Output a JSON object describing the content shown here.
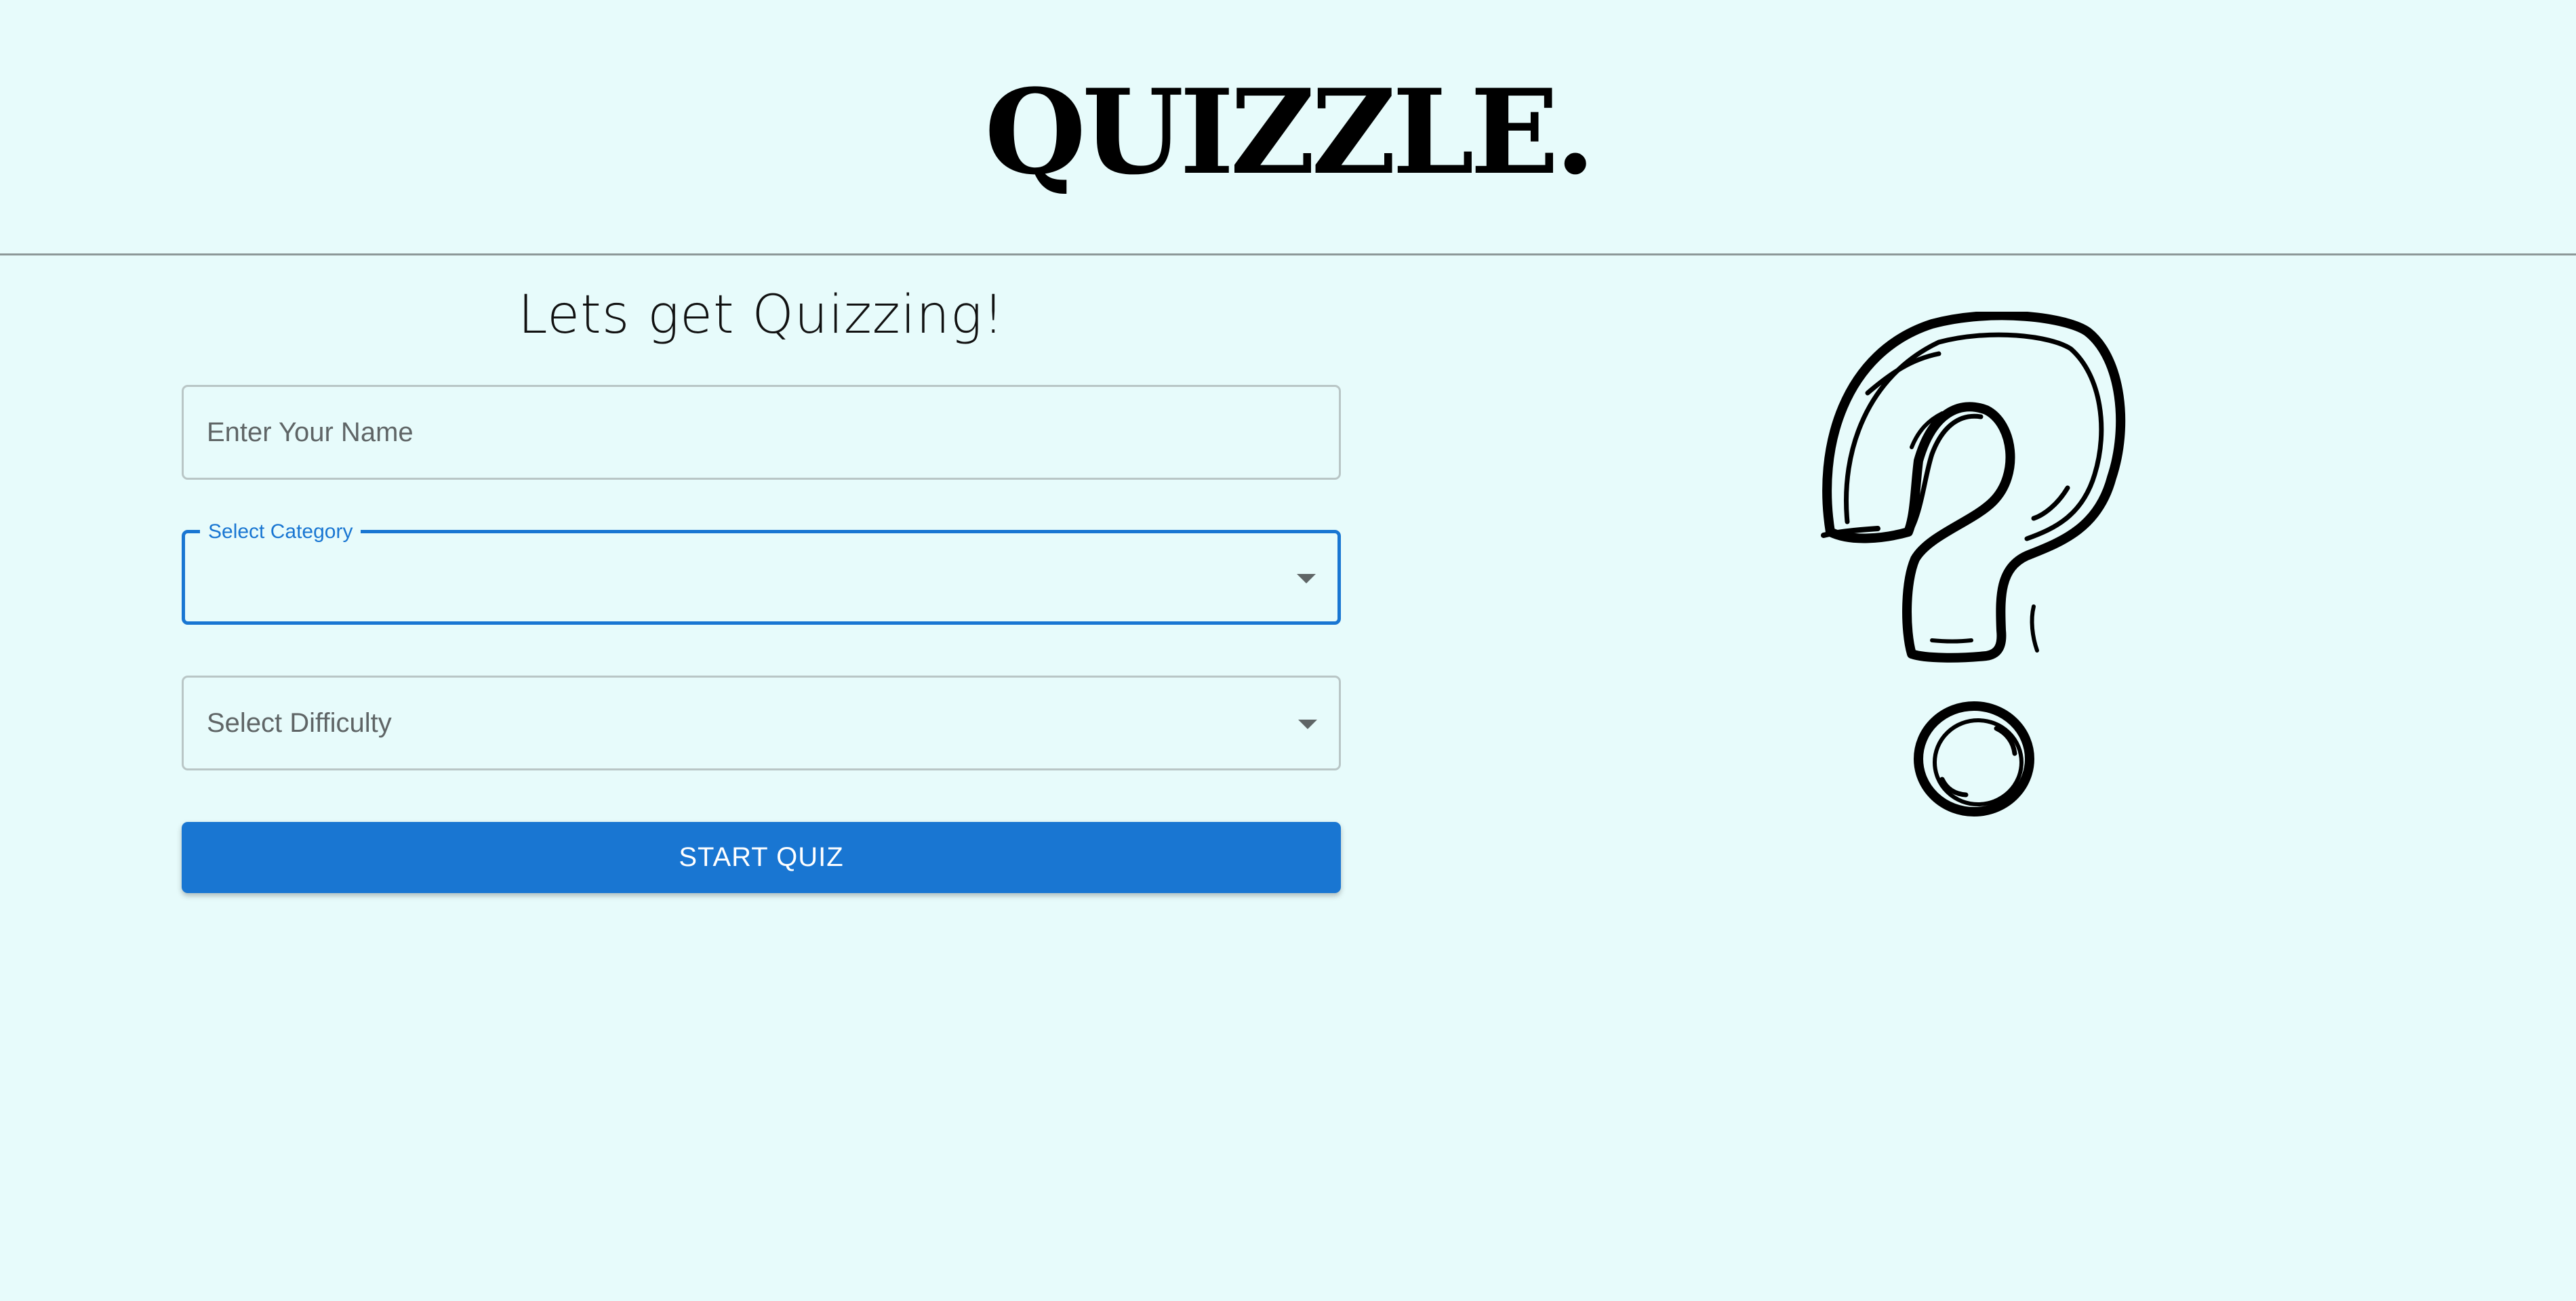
{
  "header": {
    "logo": "QUIZZLE."
  },
  "form": {
    "heading": "Lets get Quizzing!",
    "name_field": {
      "placeholder": "Enter Your Name",
      "value": ""
    },
    "category_field": {
      "label": "Select Category",
      "value": "",
      "focused": true
    },
    "difficulty_field": {
      "label": "Select Difficulty",
      "value": ""
    },
    "start_button": {
      "label": "START QUIZ"
    }
  },
  "illustration": {
    "icon": "question-mark-icon"
  },
  "colors": {
    "background": "#e7fbfb",
    "accent": "#1976d2",
    "field_border": "#b9c6c6",
    "text_muted": "#5f6566"
  }
}
